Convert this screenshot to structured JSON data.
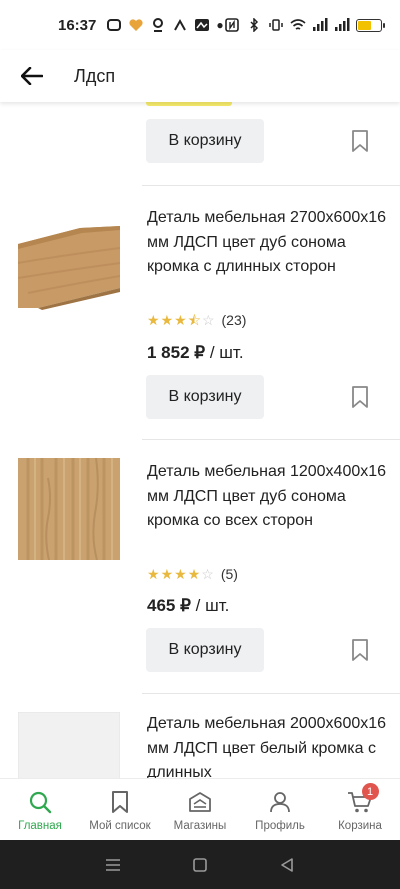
{
  "status_bar": {
    "time": "16:37",
    "battery_color": "#f2c200"
  },
  "header": {
    "title": "Лдсп",
    "back_icon": "arrow-left-icon"
  },
  "products": [
    {
      "name": "Деталь мебельная 2700x600x16 мм ЛДСП цвет дуб сонома кромка с длинных сторон",
      "rating": 3.5,
      "rating_count": "(23)",
      "price": "1 852 ₽",
      "unit": "/ шт.",
      "image": "wood-plank-oak-sonoma"
    },
    {
      "name": "Деталь мебельная 1200x400x16 мм ЛДСП цвет дуб сонома кромка со всех сторон",
      "rating": 4,
      "rating_count": "(5)",
      "price": "465 ₽",
      "unit": "/ шт.",
      "image": "wood-texture-oak-sonoma"
    },
    {
      "name": "Деталь мебельная 2000x600x16 мм ЛДСП цвет белый кромка с длинных",
      "image": "white-panel"
    }
  ],
  "cart_button_label": "В корзину",
  "bottom_nav": [
    {
      "label": "Главная",
      "icon": "search-icon",
      "active": true
    },
    {
      "label": "Мой список",
      "icon": "bookmark-icon"
    },
    {
      "label": "Магазины",
      "icon": "store-icon"
    },
    {
      "label": "Профиль",
      "icon": "user-icon"
    },
    {
      "label": "Корзина",
      "icon": "cart-icon",
      "badge": "1"
    }
  ],
  "colors": {
    "accent": "#2fa84f",
    "badge": "#e0564f",
    "star": "#e9b83e",
    "button_bg": "#eef0f2"
  }
}
